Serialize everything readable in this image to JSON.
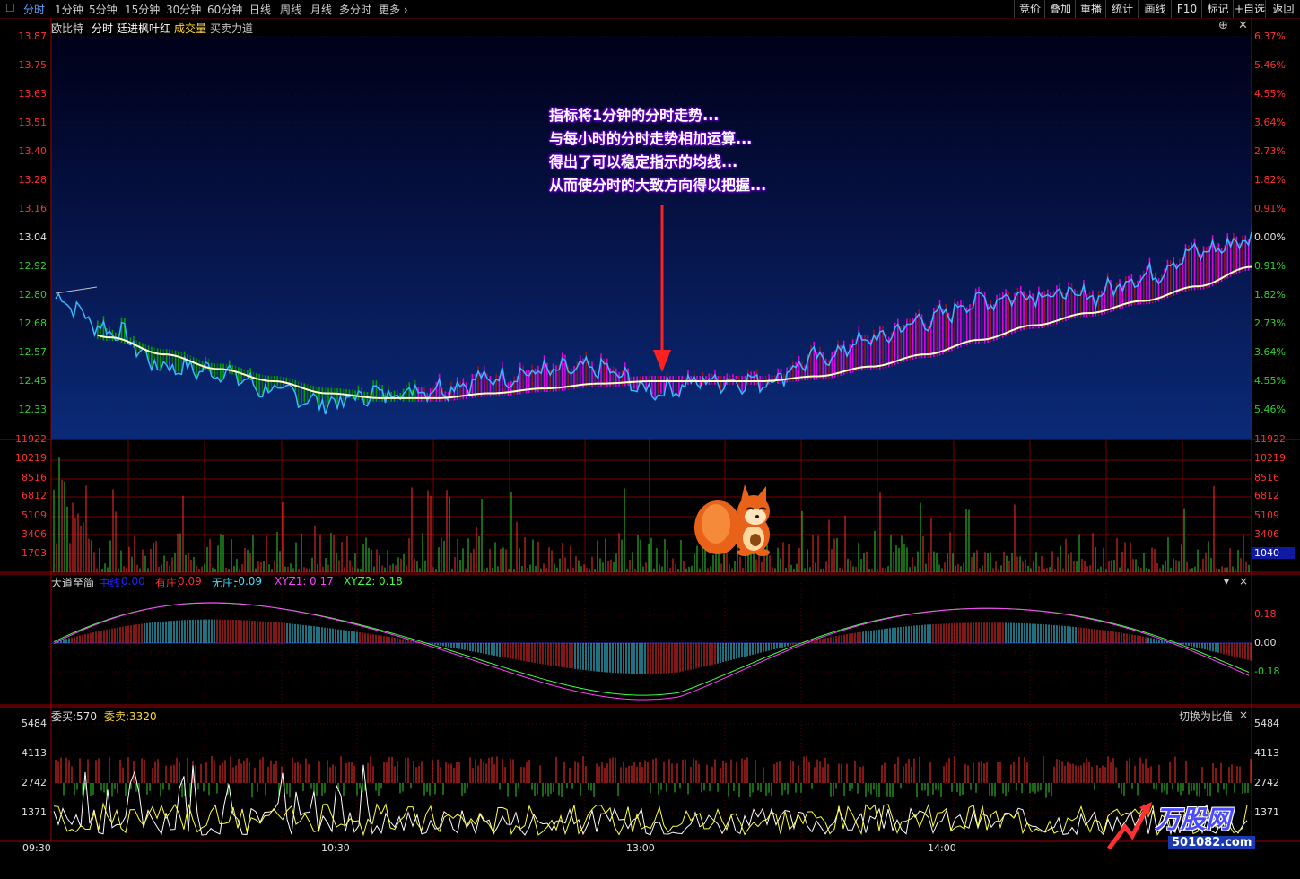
{
  "toolbar": {
    "periods": [
      "分时",
      "1分钟",
      "5分钟",
      "15分钟",
      "30分钟",
      "60分钟",
      "日线",
      "周线",
      "月线",
      "多分时",
      "更多"
    ],
    "right_buttons": [
      "竞价",
      "叠加",
      "重播",
      "统计",
      "画线",
      "F10",
      "标记",
      "+自选",
      "返回"
    ]
  },
  "header": {
    "stock_name": "欧比特",
    "label_fenshi": "分时",
    "label_indicator": "廷进枫叶红",
    "label_volume": "成交量",
    "label_maimai": "买卖力道"
  },
  "price_axis": {
    "left": [
      "13.87",
      "13.75",
      "13.63",
      "13.51",
      "13.40",
      "13.28",
      "13.16",
      "13.04",
      "12.92",
      "12.80",
      "12.68",
      "12.57",
      "12.45",
      "12.33"
    ],
    "right": [
      "6.37%",
      "5.46%",
      "4.55%",
      "3.64%",
      "2.73%",
      "1.82%",
      "0.91%",
      "0.00%",
      "0.91%",
      "1.82%",
      "2.73%",
      "3.64%",
      "4.55%",
      "5.46%"
    ]
  },
  "volume_axis": [
    "11922",
    "10219",
    "8516",
    "6812",
    "5109",
    "3406",
    "1703"
  ],
  "volume_current": "1040",
  "annotation": {
    "lines": [
      "指标将1分钟的分时走势...",
      "与每小时的分时走势相加运算...",
      "得出了可以稳定指示的均线...",
      "从而使分时的大致方向得以把握..."
    ]
  },
  "osc_panel": {
    "name": "大道至简",
    "items": [
      {
        "label": "中线:",
        "value": "0.00",
        "color": "#2222ff"
      },
      {
        "label": "有庄:",
        "value": "0.09",
        "color": "#ff3030"
      },
      {
        "label": "无庄:",
        "value": "-0.09",
        "color": "#40e0ff"
      },
      {
        "label": "XYZ1:",
        "value": "0.17",
        "color": "#ff40ff"
      },
      {
        "label": "XYZ2:",
        "value": "0.18",
        "color": "#40ff40"
      }
    ],
    "axis": [
      "0.18",
      "0.00",
      "-0.18"
    ]
  },
  "order_panel": {
    "buy_label": "委买:570",
    "sell_label": "委卖:3320",
    "switch_label": "切换为比值",
    "axis": [
      "5484",
      "4113",
      "2742",
      "1371"
    ]
  },
  "time_axis": [
    "09:30",
    "10:30",
    "13:00",
    "14:00"
  ],
  "watermark": {
    "text": "万股网",
    "url": "501082.com"
  },
  "colors": {
    "price_line": "#3ab8ff",
    "avg_line": "#ffffc0",
    "up_bar": "#e000e0",
    "down_bar": "#00a000",
    "grid": "#a00000"
  },
  "chart_data": {
    "type": "line",
    "title": "",
    "ylim": [
      12.21,
      13.87
    ],
    "x": [
      "09:30",
      "10:30",
      "13:00",
      "14:00"
    ],
    "series": [
      {
        "name": "",
        "values": [
          12.79,
          12.66,
          12.51,
          12.49,
          12.41,
          12.36,
          12.4,
          12.42,
          12.46,
          12.49,
          12.5,
          12.41,
          12.45,
          12.45,
          12.54,
          12.62,
          12.7,
          12.78,
          12.81,
          12.8,
          12.88,
          12.98,
          13.03
        ]
      },
      {
        "name": "",
        "values": [
          12.7,
          12.63,
          12.56,
          12.5,
          12.45,
          12.4,
          12.38,
          12.38,
          12.4,
          12.42,
          12.44,
          12.45,
          12.45,
          12.45,
          12.47,
          12.51,
          12.56,
          12.62,
          12.68,
          12.73,
          12.78,
          12.84,
          12.92
        ]
      }
    ]
  }
}
